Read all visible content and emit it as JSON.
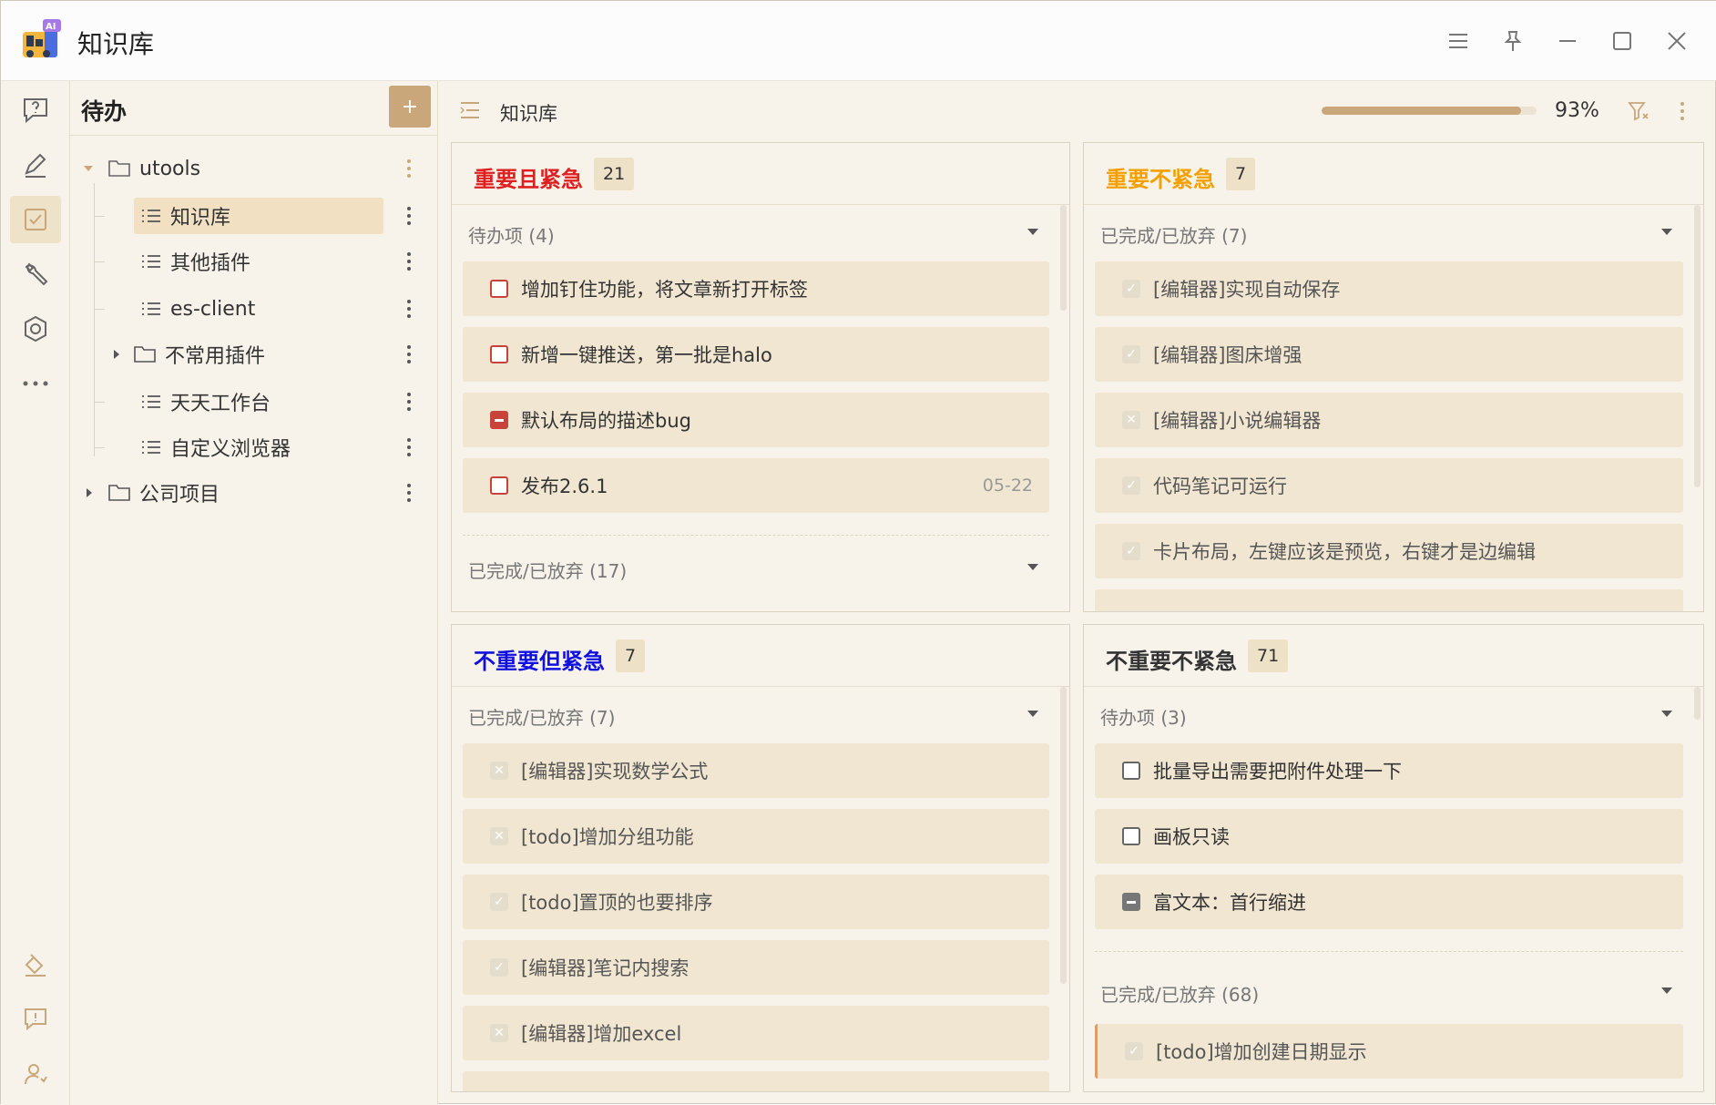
{
  "app": {
    "title": "知识库",
    "logo_badge": "AI"
  },
  "colors": {
    "accent": "#c9a77b",
    "urgent_important": "#e02020",
    "important": "#f5a000",
    "urgent": "#1010e0",
    "neither": "#333333"
  },
  "rail": {
    "icons": [
      "question-icon",
      "edit-icon",
      "checkbox-icon",
      "tools-icon",
      "settings-icon",
      "more-icon",
      "paint-icon",
      "feedback-icon",
      "user-icon"
    ]
  },
  "sidebar": {
    "title": "待办",
    "add_label": "+",
    "tree": [
      {
        "label": "utools",
        "type": "folder"
      },
      {
        "label": "知识库",
        "type": "list"
      },
      {
        "label": "其他插件",
        "type": "list"
      },
      {
        "label": "es-client",
        "type": "list"
      },
      {
        "label": "不常用插件",
        "type": "folder"
      },
      {
        "label": "天天工作台",
        "type": "list"
      },
      {
        "label": "自定义浏览器",
        "type": "list"
      },
      {
        "label": "公司项目",
        "type": "folder"
      }
    ]
  },
  "main": {
    "breadcrumb": "知识库",
    "progress": {
      "percent": 93,
      "text": "93%"
    }
  },
  "quadrants": {
    "q1": {
      "title": "重要且紧急",
      "count": "21",
      "group_open": "待办项 (4)",
      "tasks": [
        {
          "text": "增加钉住功能，将文章新打开标签"
        },
        {
          "text": "新增一键推送，第一批是halo"
        },
        {
          "text": "默认布局的描述bug"
        },
        {
          "text": "发布2.6.1",
          "date": "05-22"
        }
      ],
      "group_done": "已完成/已放弃 (17)"
    },
    "q2": {
      "title": "重要不紧急",
      "count": "7",
      "group_done": "已完成/已放弃 (7)",
      "tasks": [
        {
          "text": "[编辑器]实现自动保存",
          "mark": "✓"
        },
        {
          "text": "[编辑器]图床增强",
          "mark": "✓"
        },
        {
          "text": "[编辑器]小说编辑器",
          "mark": "✕"
        },
        {
          "text": "代码笔记可运行",
          "mark": "✓"
        },
        {
          "text": "卡片布局，左键应该是预览，右键才是边编辑",
          "mark": "✓"
        }
      ]
    },
    "q3": {
      "title": "不重要但紧急",
      "count": "7",
      "group_done": "已完成/已放弃 (7)",
      "tasks": [
        {
          "text": "[编辑器]实现数学公式",
          "mark": "✕"
        },
        {
          "text": "[todo]增加分组功能",
          "mark": "✕"
        },
        {
          "text": "[todo]置顶的也要排序",
          "mark": "✓"
        },
        {
          "text": "[编辑器]笔记内搜索",
          "mark": "✓"
        },
        {
          "text": "[编辑器]增加excel",
          "mark": "✕"
        }
      ]
    },
    "q4": {
      "title": "不重要不紧急",
      "count": "71",
      "group_open": "待办项 (3)",
      "tasks": [
        {
          "text": "批量导出需要把附件处理一下"
        },
        {
          "text": "画板只读"
        },
        {
          "text": "富文本：首行缩进"
        }
      ],
      "group_done": "已完成/已放弃 (68)",
      "done_tasks": [
        {
          "text": "[todo]增加创建日期显示",
          "mark": "✓"
        }
      ]
    }
  }
}
